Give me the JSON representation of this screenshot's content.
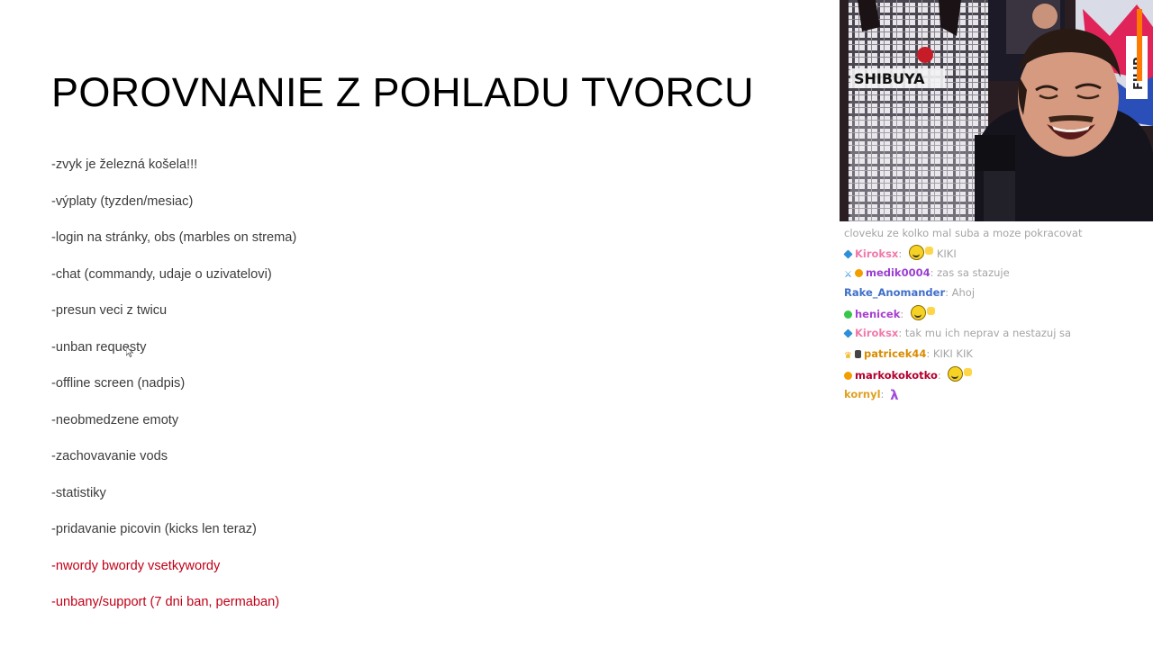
{
  "slide": {
    "title": "POROVNANIE Z POHLADU TVORCU",
    "bullets": [
      {
        "text": "-zvyk je železná košela!!!",
        "color": "gray"
      },
      {
        "text": "-výplaty (tyzden/mesiac)",
        "color": "gray"
      },
      {
        "text": "-login na stránky, obs (marbles on strema)",
        "color": "gray"
      },
      {
        "text": "-chat (commandy, udaje o uzivatelovi)",
        "color": "gray"
      },
      {
        "text": "-presun veci z twicu",
        "color": "gray"
      },
      {
        "text": "-unban requesty",
        "color": "gray"
      },
      {
        "text": "-offline screen (nadpis)",
        "color": "gray"
      },
      {
        "text": "-neobmedzene emoty",
        "color": "gray"
      },
      {
        "text": "-zachovavanie vods",
        "color": "gray"
      },
      {
        "text": "-statistiky",
        "color": "gray"
      },
      {
        "text": "-pridavanie picovin (kicks len teraz)",
        "color": "gray"
      },
      {
        "text": "-nwordy bwordy vsetkywordy",
        "color": "red"
      },
      {
        "text": "-unbany/support (7 dni ban, permaban)",
        "color": "red"
      }
    ]
  },
  "webcam": {
    "shirt_text": "SHIBUYA",
    "poster_text": "FILIP"
  },
  "chat": {
    "messages": [
      {
        "user": "",
        "user_color": "#a4a4a4",
        "text": "cloveku ze kolko mal suba a moze pokracovat",
        "badges": [],
        "emote": ""
      },
      {
        "user": "Kiroksx",
        "user_color": "#f07aa8",
        "text": "KIKI",
        "badges": [
          "blue"
        ],
        "emote": "smile"
      },
      {
        "user": "medik0004",
        "user_color": "#9b3fd1",
        "text": "zas sa stazuje",
        "badges": [
          "sword",
          "orange"
        ],
        "emote": ""
      },
      {
        "user": "Rake_Anomander",
        "user_color": "#3f6fc8",
        "text": "Ahoj",
        "badges": [],
        "emote": ""
      },
      {
        "user": "henicek",
        "user_color": "#a63fd1",
        "text": "",
        "badges": [
          "green"
        ],
        "emote": "smile"
      },
      {
        "user": "Kiroksx",
        "user_color": "#f07aa8",
        "text": "tak mu ich neprav a nestazuj sa",
        "badges": [
          "blue"
        ],
        "emote": ""
      },
      {
        "user": "patricek44",
        "user_color": "#d98c00",
        "text": "KIKI KIK",
        "badges": [
          "crown",
          "dark"
        ],
        "emote": ""
      },
      {
        "user": "markokokotko",
        "user_color": "#b3002d",
        "text": "",
        "badges": [
          "orange"
        ],
        "emote": "smile"
      },
      {
        "user": "kornyl",
        "user_color": "#e0a020",
        "text": "",
        "badges": [],
        "emote": "purple"
      }
    ]
  }
}
